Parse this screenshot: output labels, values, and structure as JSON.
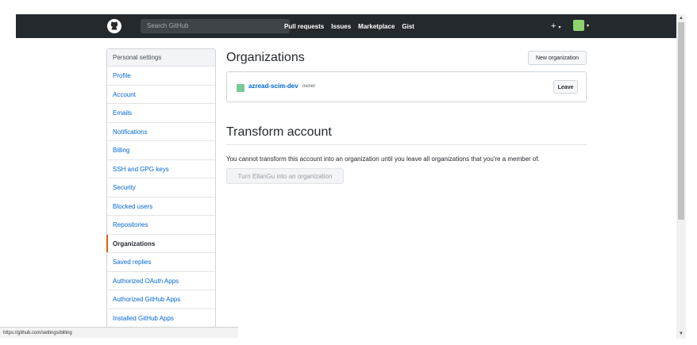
{
  "header": {
    "search_placeholder": "Search GitHub",
    "nav": [
      "Pull requests",
      "Issues",
      "Marketplace",
      "Gist"
    ],
    "plus": "+",
    "caret": "▾"
  },
  "sidebar": {
    "header": "Personal settings",
    "items": [
      {
        "label": "Profile"
      },
      {
        "label": "Account"
      },
      {
        "label": "Emails"
      },
      {
        "label": "Notifications"
      },
      {
        "label": "Billing"
      },
      {
        "label": "SSH and GPG keys"
      },
      {
        "label": "Security"
      },
      {
        "label": "Blocked users"
      },
      {
        "label": "Repositories"
      },
      {
        "label": "Organizations",
        "selected": true
      },
      {
        "label": "Saved replies"
      },
      {
        "label": "Authorized OAuth Apps"
      },
      {
        "label": "Authorized GitHub Apps"
      },
      {
        "label": "Installed GitHub Apps"
      }
    ]
  },
  "main": {
    "organizations_title": "Organizations",
    "new_org_button": "New organization",
    "org": {
      "name": "azread-scim-dev",
      "role": "owner",
      "leave_button": "Leave"
    },
    "transform_title": "Transform account",
    "transform_text": "You cannot transform this account into an organization until you leave all organizations that you're a member of.",
    "turn_button": "Turn EllanGu into an organization"
  },
  "status_bar": {
    "url": "https://github.com/settings/billing"
  },
  "colors": {
    "topnav": "#24292e",
    "link": "#0366d6",
    "selected_accent": "#e36209",
    "avatar": "#8ed36d"
  },
  "icons": {
    "logo": "github-octocat-icon",
    "avatar": "user-avatar-icon"
  }
}
